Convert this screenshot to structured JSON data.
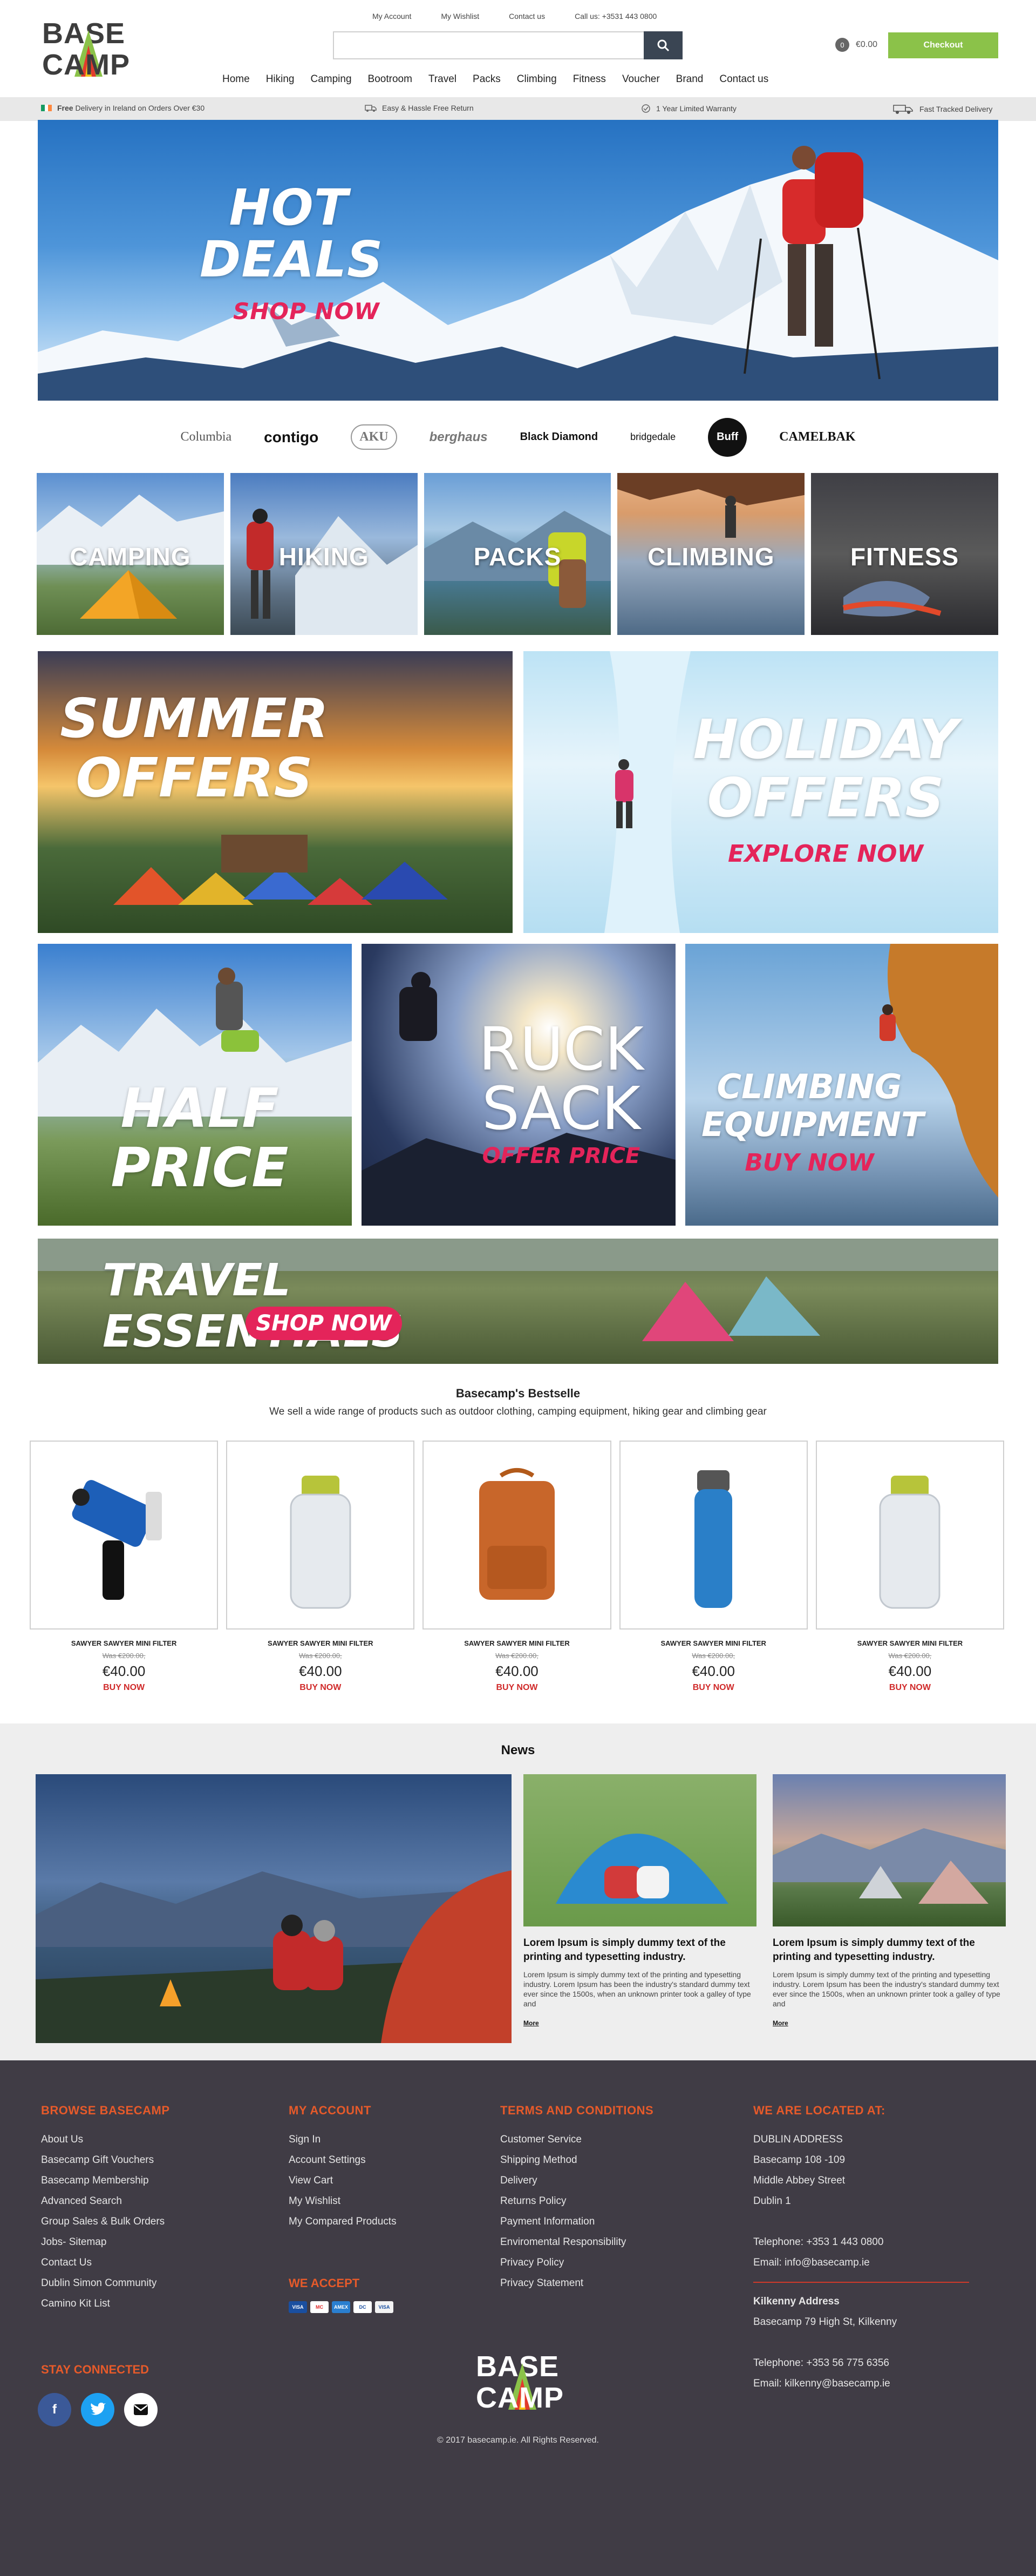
{
  "header": {
    "logo_line1": "BASE",
    "logo_line2": "CAMP",
    "top_links": [
      "My Account",
      "My Wishlist",
      "Contact us",
      "Call us: +3531 443 0800"
    ],
    "search_placeholder": "",
    "cart_count": "0",
    "cart_total": "€0.00",
    "checkout_label": "Checkout",
    "nav": [
      "Home",
      "Hiking",
      "Camping",
      "Bootroom",
      "Travel",
      "Packs",
      "Climbing",
      "Fitness",
      "Voucher",
      "Brand",
      "Contact us"
    ]
  },
  "infobar": {
    "delivery_bold": "Free",
    "delivery_text": "Delivery in Ireland  on Orders Over €30",
    "returns": "Easy & Hassle Free Return",
    "warranty": "1 Year Limited Warranty",
    "fast": "Fast Tracked Delivery"
  },
  "hero": {
    "title_line1": "HOT",
    "title_line2": "DEALS",
    "cta": "SHOP NOW"
  },
  "brands": [
    "Columbia",
    "contigo",
    "AKU",
    "berghaus",
    "Black Diamond",
    "bridgedale",
    "Buff",
    "CAMELBAK"
  ],
  "categories": [
    "CAMPING",
    "HIKING",
    "PACKS",
    "CLIMBING",
    "FITNESS"
  ],
  "promos": {
    "summer": {
      "line1": "SUMMER",
      "line2": "OFFERS"
    },
    "holiday": {
      "line1": "HOLIDAY",
      "line2": "OFFERS",
      "cta": "EXPLORE NOW"
    },
    "half": {
      "line1": "HALF",
      "line2": "PRICE"
    },
    "ruck": {
      "line1": "RUCK",
      "line2": "SACK",
      "cta": "OFFER PRICE"
    },
    "climbing": {
      "line1": "CLIMBING",
      "line2": "EQUIPMENT",
      "cta": "BUY NOW"
    },
    "travel": {
      "title": "TRAVEL ESSENTIALS",
      "cta": "SHOP NOW"
    }
  },
  "bestsellers": {
    "title": "Basecamp's Bestselle",
    "subtitle": "We sell a wide range of products such as outdoor clothing, camping equipment, hiking gear and climbing gear",
    "products": [
      {
        "name": "SAWYER SAWYER MINI FILTER",
        "was": "Was €200.00,",
        "price": "€40.00",
        "buy": "BUY NOW",
        "kind": "filter"
      },
      {
        "name": "SAWYER SAWYER MINI FILTER",
        "was": "Was €200.00,",
        "price": "€40.00",
        "buy": "BUY NOW",
        "kind": "bottle"
      },
      {
        "name": "SAWYER SAWYER MINI FILTER",
        "was": "Was €200.00,",
        "price": "€40.00",
        "buy": "BUY NOW",
        "kind": "backpack"
      },
      {
        "name": "SAWYER SAWYER MINI FILTER",
        "was": "Was €200.00,",
        "price": "€40.00",
        "buy": "BUY NOW",
        "kind": "bluebottle"
      },
      {
        "name": "SAWYER SAWYER MINI FILTER",
        "was": "Was €200.00,",
        "price": "€40.00",
        "buy": "BUY NOW",
        "kind": "bottle"
      }
    ]
  },
  "news": {
    "title": "News",
    "cards": [
      {
        "title": "Lorem Ipsum is simply dummy text of the printing and typesetting industry.",
        "text": "Lorem Ipsum is simply dummy text of the printing and typesetting industry. Lorem Ipsum has been the industry's standard dummy text ever since the 1500s, when an unknown printer took a galley of type and",
        "more": "More"
      },
      {
        "title": "Lorem Ipsum is simply dummy text of the printing and typesetting industry.",
        "text": "Lorem Ipsum is simply dummy text of the printing and typesetting industry. Lorem Ipsum has been the industry's standard dummy text ever since the 1500s, when an unknown printer took a galley of type and",
        "more": "More"
      }
    ]
  },
  "footer": {
    "browse": {
      "heading": "BROWSE BASECAMP",
      "links": [
        "About Us",
        "Basecamp Gift Vouchers",
        "Basecamp Membership",
        "Advanced Search",
        "Group Sales & Bulk Orders",
        "Jobs- Sitemap",
        "Contact Us",
        "Dublin Simon Community",
        "Camino Kit List"
      ]
    },
    "account": {
      "heading": "MY ACCOUNT",
      "links": [
        "Sign In",
        "Account Settings",
        "View Cart",
        "My Wishlist",
        "My Compared Products"
      ]
    },
    "terms": {
      "heading": "TERMS AND CONDITIONS",
      "links": [
        "Customer Service",
        "Shipping Method",
        "Delivery",
        "Returns Policy",
        "Payment Information",
        "Enviromental Responsibility",
        "Privacy Policy",
        "Privacy Statement"
      ]
    },
    "located": {
      "heading": "WE ARE LOCATED AT:",
      "dublin": [
        "DUBLIN ADDRESS",
        "Basecamp 108 -109",
        "Middle Abbey Street",
        "Dublin 1"
      ],
      "dublin_phone": "Telephone: +353 1 443 0800",
      "dublin_email": "Email: info@basecamp.ie",
      "kilkenny_heading": "Kilkenny Address",
      "kilkenny_addr": "Basecamp 79 High St, Kilkenny",
      "kilkenny_phone": "Telephone: +353 56 775 6356",
      "kilkenny_email": "Email: kilkenny@basecamp.ie"
    },
    "we_accept": "WE ACCEPT",
    "cards": [
      "VISA",
      "MC",
      "AMEX",
      "DC",
      "VISA"
    ],
    "stay_connected": "STAY CONNECTED",
    "copyright": "© 2017 basecamp.ie. All Rights Reserved."
  },
  "colors": {
    "accent_green": "#8bc249",
    "footer_bg": "#403c45",
    "footer_heading": "#e65a2a",
    "promo_pink": "#e4245a",
    "buy_red": "#d02a2a"
  }
}
